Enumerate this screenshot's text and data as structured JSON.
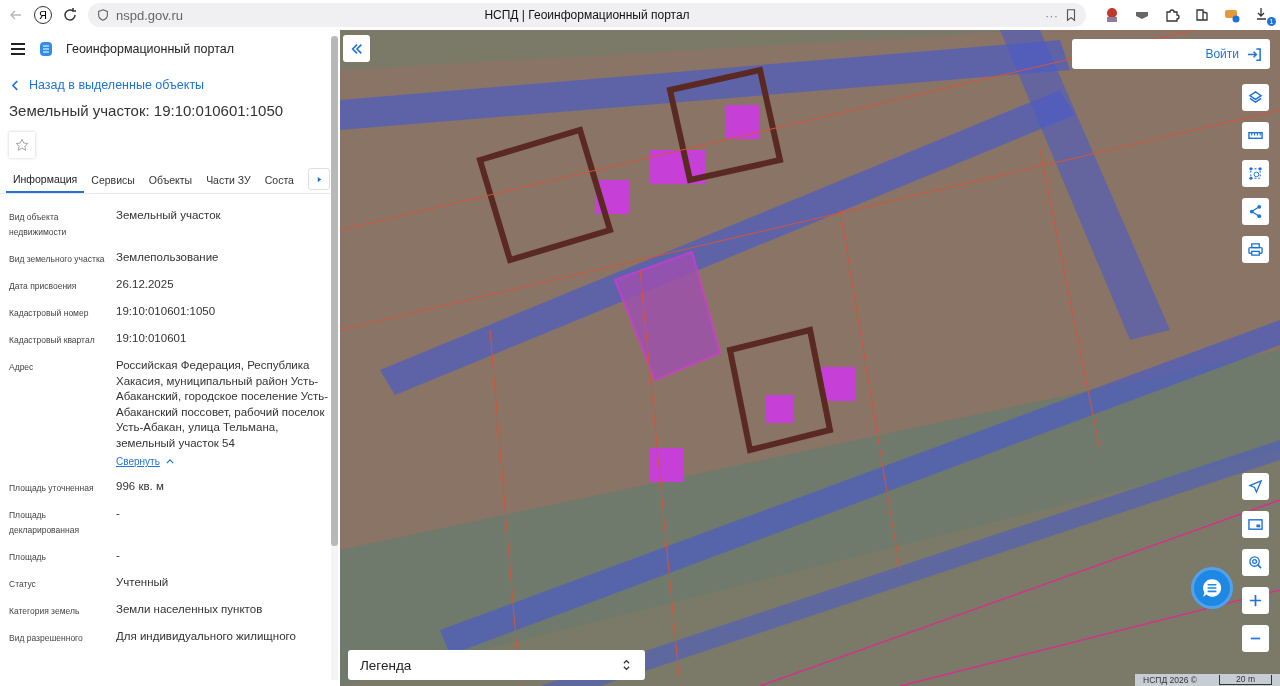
{
  "browser": {
    "logo_letter": "Я",
    "url": "nspd.gov.ru",
    "tab_title": "НСПД | Геоинформационный портал",
    "menu_dots": "···",
    "download_count": "1"
  },
  "sidebar": {
    "app_title": "Геоинформационный портал",
    "back_link": "Назад в выделенные объекты",
    "heading": "Земельный участок: 19:10:010601:1050",
    "tabs": [
      {
        "label": "Информация",
        "selected": true
      },
      {
        "label": "Сервисы",
        "selected": false
      },
      {
        "label": "Объекты",
        "selected": false
      },
      {
        "label": "Части ЗУ",
        "selected": false
      },
      {
        "label": "Соста",
        "selected": false
      }
    ],
    "fields": [
      {
        "label": "Вид объекта недвижимости",
        "value": "Земельный участок"
      },
      {
        "label": "Вид земельного участка",
        "value": "Землепользование"
      },
      {
        "label": "Дата присвоения",
        "value": "26.12.2025"
      },
      {
        "label": "Кадастровый номер",
        "value": "19:10:010601:1050"
      },
      {
        "label": "Кадастровый квартал",
        "value": "19:10:010601"
      },
      {
        "label": "Адрес",
        "value": "Российская Федерация, Республика Хакасия, муниципальный район Усть-Абаканский, городское поселение Усть-Абаканский поссовет, рабочий поселок Усть-Абакан, улица Тельмана, земельный участок 54",
        "link": "Свернуть"
      },
      {
        "label": "Площадь уточненная",
        "value": "996 кв. м"
      },
      {
        "label": "Площадь декларированная",
        "value": "-"
      },
      {
        "label": "Площадь",
        "value": "-"
      },
      {
        "label": "Статус",
        "value": "Учтенный"
      },
      {
        "label": "Категория земель",
        "value": "Земли населенных пунктов"
      },
      {
        "label": "Вид разрешенного",
        "value": "Для индивидуального жилищного"
      }
    ]
  },
  "map": {
    "login": "Войти",
    "tools": [
      {
        "kind": "layers"
      },
      {
        "kind": "ruler"
      },
      {
        "kind": "select"
      },
      {
        "kind": "share"
      },
      {
        "kind": "print"
      }
    ],
    "nav": [
      {
        "kind": "locate"
      },
      {
        "kind": "minimap"
      },
      {
        "kind": "search"
      },
      {
        "kind": "plus"
      },
      {
        "kind": "minus"
      }
    ],
    "legend": "Легенда",
    "attribution": "НСПД 2026 ©",
    "scale": "20 m"
  }
}
